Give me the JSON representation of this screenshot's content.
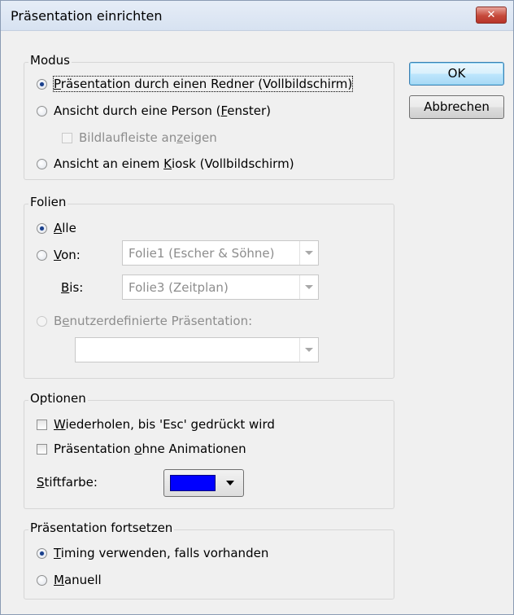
{
  "window": {
    "title": "Präsentation einrichten",
    "close_icon": "close-icon"
  },
  "buttons": {
    "ok": "OK",
    "cancel": "Abbrechen"
  },
  "modus": {
    "title": "Modus",
    "options": [
      {
        "before": "",
        "mnemonic": "P",
        "after": "räsentation durch einen Redner (Vollbildschirm)",
        "checked": true
      },
      {
        "before": "Ansicht durch eine Person (",
        "mnemonic": "F",
        "after": "enster)",
        "checked": false
      },
      {
        "before": "Ansicht an einem ",
        "mnemonic": "K",
        "after": "iosk (Vollbildschirm)",
        "checked": false
      }
    ],
    "scrollbar_checkbox": {
      "before": "Bildlaufleiste an",
      "mnemonic": "z",
      "after": "eigen",
      "checked": false,
      "enabled": false
    }
  },
  "folien": {
    "title": "Folien",
    "alle": {
      "before": "",
      "mnemonic": "A",
      "after": "lle",
      "checked": true
    },
    "von": {
      "before": "",
      "mnemonic": "V",
      "after": "on:",
      "checked": false,
      "value": "Folie1 (Escher & Söhne)"
    },
    "bis": {
      "before": "",
      "mnemonic": "B",
      "after": "is:",
      "value": "Folie3 (Zeitplan)"
    },
    "custom": {
      "before": "B",
      "mnemonic": "e",
      "after": "nutzerdefinierte Präsentation:",
      "enabled": false,
      "value": ""
    }
  },
  "optionen": {
    "title": "Optionen",
    "loop": {
      "before": "",
      "mnemonic": "W",
      "after": "iederholen, bis 'Esc' gedrückt wird",
      "checked": false
    },
    "no_animation": {
      "before": "Präsentation ",
      "mnemonic": "o",
      "after": "hne Animationen",
      "checked": false
    },
    "pen": {
      "before": "",
      "mnemonic": "S",
      "after": "tiftfarbe:",
      "color": "#0000ff"
    }
  },
  "fortsetzen": {
    "title": "Präsentation fortsetzen",
    "timing": {
      "before": "",
      "mnemonic": "T",
      "after": "iming verwenden, falls vorhanden",
      "checked": true
    },
    "manual": {
      "before": "",
      "mnemonic": "M",
      "after": "anuell",
      "checked": false
    }
  },
  "colors": {
    "accent": "#3c7fb1",
    "close": "#c64a3b",
    "disabled_text": "#8d8d8d"
  }
}
